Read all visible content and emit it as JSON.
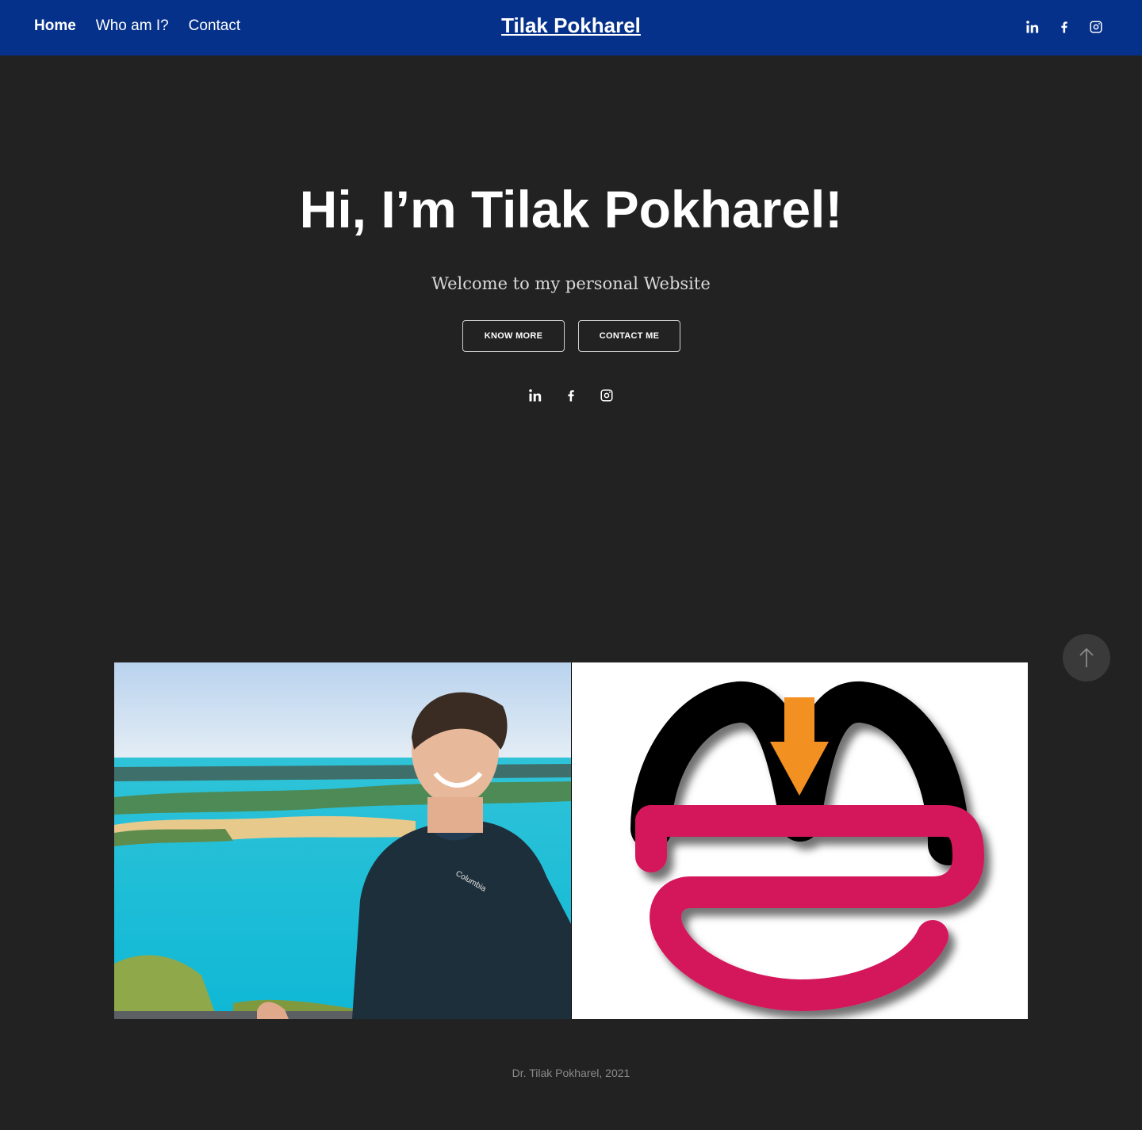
{
  "header": {
    "nav": [
      {
        "label": "Home",
        "active": true
      },
      {
        "label": "Who am I?",
        "active": false
      },
      {
        "label": "Contact",
        "active": false
      }
    ],
    "site_title": "Tilak Pokharel",
    "social": [
      "linkedin-icon",
      "facebook-icon",
      "instagram-icon"
    ]
  },
  "hero": {
    "title": "Hi, I’m Tilak Pokharel!",
    "subtitle": "Welcome to my personal Website",
    "buttons": {
      "know_more": "Know More",
      "contact_me": "Contact Me"
    },
    "social": [
      "linkedin-icon",
      "facebook-icon",
      "instagram-icon"
    ]
  },
  "gallery": {
    "photo_brand": "Columbia"
  },
  "footer": {
    "text": "Dr. Tilak Pokharel, 2021"
  },
  "colors": {
    "header_bg": "#05318a",
    "page_bg": "#222222",
    "logo_orange": "#f39020",
    "logo_pink": "#d4155a",
    "logo_black": "#000000"
  }
}
